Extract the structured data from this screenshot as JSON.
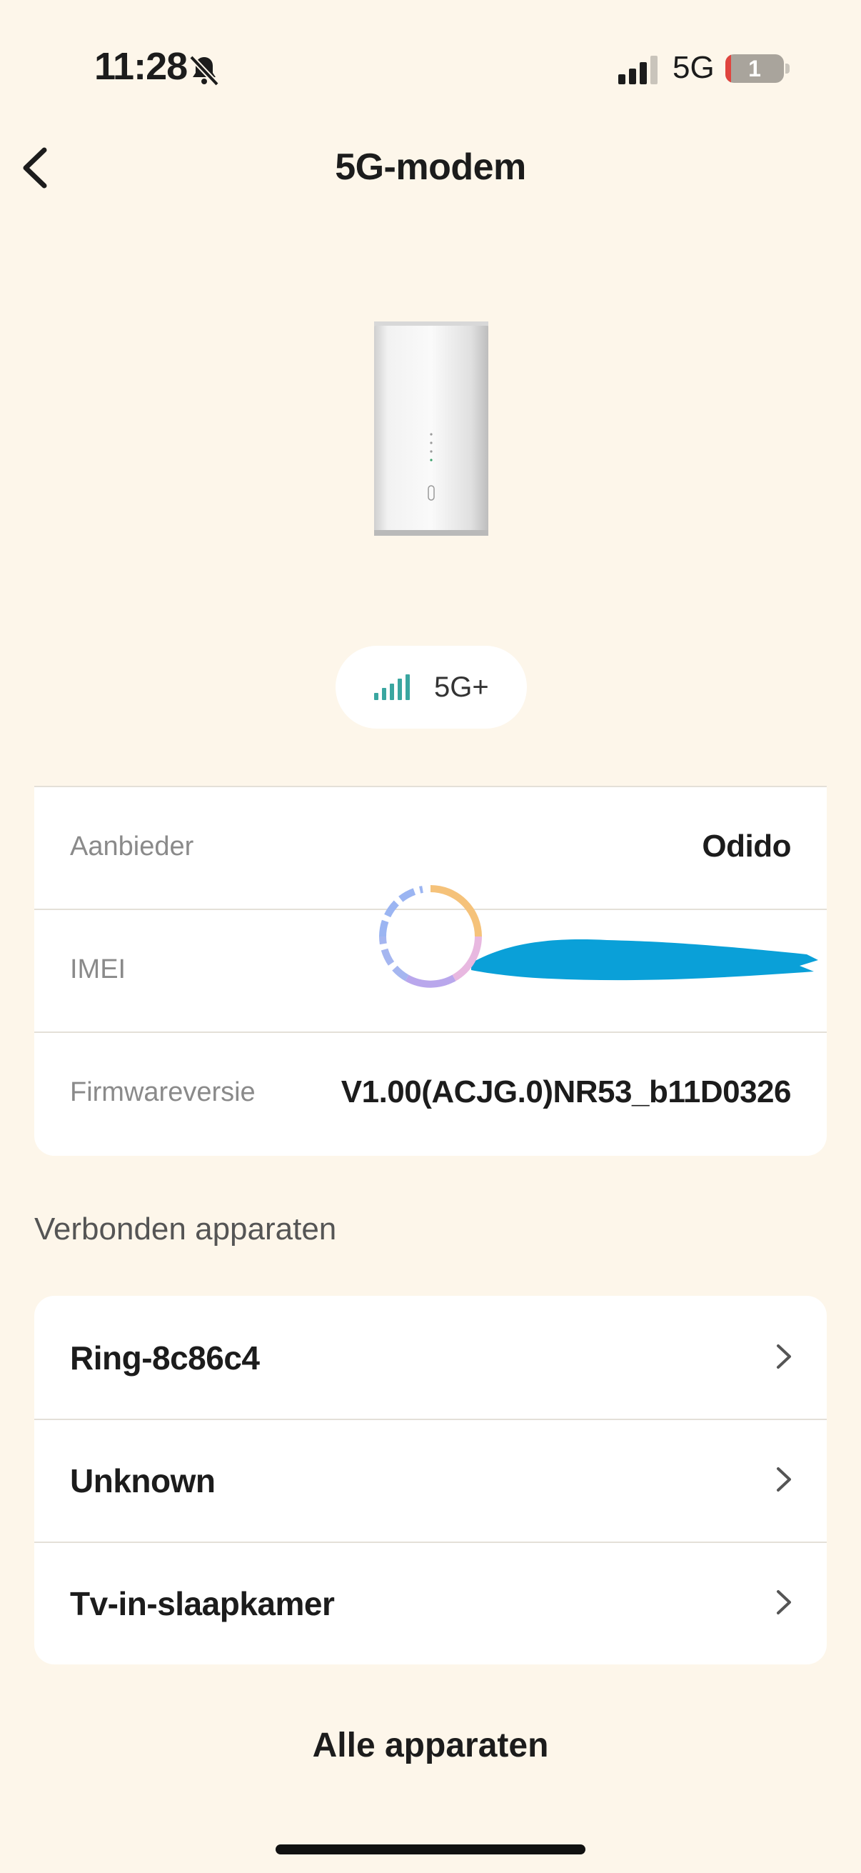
{
  "status_bar": {
    "time": "11:28",
    "network": "5G",
    "battery": "1"
  },
  "header": {
    "title": "5G-modem"
  },
  "signal": {
    "label": "5G+"
  },
  "info": [
    {
      "label": "Aanbieder",
      "value": "Odido"
    },
    {
      "label": "IMEI",
      "value": ""
    },
    {
      "label": "Firmwareversie",
      "value": "V1.00(ACJG.0)NR53_b11D0326"
    }
  ],
  "connected": {
    "title": "Verbonden apparaten",
    "devices": [
      {
        "name": "Ring-8c86c4"
      },
      {
        "name": "Unknown"
      },
      {
        "name": "Tv-in-slaapkamer"
      }
    ],
    "all_label": "Alle apparaten"
  },
  "colors": {
    "background": "#fdf6ea",
    "signal_teal": "#3aa6a0",
    "redaction": "#0aa0d8"
  }
}
